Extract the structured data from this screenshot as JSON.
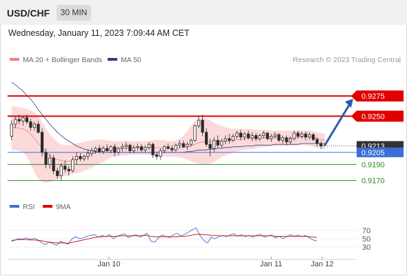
{
  "header": {
    "symbol": "USD/CHF",
    "timeframe": "30 MIN",
    "datetime": "Wednesday, January 11, 2023 7:09:44 AM CET"
  },
  "chart_data": [
    {
      "type": "candlestick",
      "legend": [
        {
          "label": "MA 20 + Bollinger Bands",
          "color": "#f08080"
        },
        {
          "label": "MA 50",
          "color": "#2c3e8c"
        }
      ],
      "credit": "Research © 2023 Trading Central",
      "legend_placement": "top-left",
      "x_tick_labels": [
        "Jan 10",
        "Jan 11",
        "Jan 12"
      ],
      "ylim": [
        0.915,
        0.93
      ],
      "levels": [
        {
          "value": 0.9275,
          "label": "0.9275",
          "kind": "target",
          "color": "#e00000"
        },
        {
          "value": 0.925,
          "label": "0.9250",
          "kind": "resistance",
          "color": "#e00000"
        },
        {
          "value": 0.9213,
          "label": "0.9213",
          "kind": "last-price",
          "color": "#333333"
        },
        {
          "value": 0.9205,
          "label": "0.9205",
          "kind": "pivot",
          "color": "#3a6fd8"
        },
        {
          "value": 0.919,
          "label": "0.9190",
          "kind": "support",
          "color": "#2e8b22"
        },
        {
          "value": 0.917,
          "label": "0.9170",
          "kind": "support",
          "color": "#2e8b22"
        }
      ],
      "colors": {
        "up": "#2a2a2a",
        "down": "#2a2a2a",
        "bollinger_fill": "#fcdada",
        "ma20": "#f08080",
        "ma50": "#2c3e8c",
        "arrow": "#2b5ea8"
      },
      "candles": [
        [
          0.9225,
          0.9245,
          0.922,
          0.924
        ],
        [
          0.924,
          0.925,
          0.9235,
          0.9246
        ],
        [
          0.9246,
          0.9252,
          0.924,
          0.9244
        ],
        [
          0.9244,
          0.925,
          0.9238,
          0.9248
        ],
        [
          0.9248,
          0.9252,
          0.924,
          0.9243
        ],
        [
          0.9243,
          0.9247,
          0.9232,
          0.9236
        ],
        [
          0.9236,
          0.9243,
          0.9232,
          0.924
        ],
        [
          0.924,
          0.9244,
          0.9228,
          0.923
        ],
        [
          0.923,
          0.9235,
          0.92,
          0.9205
        ],
        [
          0.9205,
          0.921,
          0.9185,
          0.919
        ],
        [
          0.919,
          0.9203,
          0.9185,
          0.9198
        ],
        [
          0.9198,
          0.9202,
          0.9178,
          0.9182
        ],
        [
          0.9182,
          0.9186,
          0.9172,
          0.9176
        ],
        [
          0.9176,
          0.9192,
          0.917,
          0.9188
        ],
        [
          0.9188,
          0.9195,
          0.918,
          0.9184
        ],
        [
          0.9184,
          0.9188,
          0.9176,
          0.9182
        ],
        [
          0.9182,
          0.92,
          0.918,
          0.9196
        ],
        [
          0.9196,
          0.9205,
          0.919,
          0.92
        ],
        [
          0.92,
          0.9204,
          0.9194,
          0.9197
        ],
        [
          0.9197,
          0.9202,
          0.9194,
          0.92
        ],
        [
          0.92,
          0.9208,
          0.9196,
          0.9204
        ],
        [
          0.9204,
          0.9211,
          0.92,
          0.9207
        ],
        [
          0.9207,
          0.9212,
          0.9203,
          0.921
        ],
        [
          0.921,
          0.9214,
          0.9204,
          0.9206
        ],
        [
          0.9206,
          0.9213,
          0.9203,
          0.921
        ],
        [
          0.921,
          0.9215,
          0.9205,
          0.9207
        ],
        [
          0.9207,
          0.9214,
          0.9204,
          0.9212
        ],
        [
          0.9212,
          0.9216,
          0.92,
          0.9205
        ],
        [
          0.9205,
          0.9212,
          0.9202,
          0.921
        ],
        [
          0.921,
          0.9216,
          0.9206,
          0.9212
        ],
        [
          0.9212,
          0.9218,
          0.9208,
          0.9214
        ],
        [
          0.9214,
          0.9216,
          0.9204,
          0.9207
        ],
        [
          0.9207,
          0.9214,
          0.9204,
          0.9211
        ],
        [
          0.9211,
          0.9216,
          0.9207,
          0.9212
        ],
        [
          0.9212,
          0.9215,
          0.9206,
          0.9208
        ],
        [
          0.9208,
          0.9214,
          0.9205,
          0.9211
        ],
        [
          0.9211,
          0.9218,
          0.9208,
          0.9215
        ],
        [
          0.9215,
          0.9217,
          0.9198,
          0.9202
        ],
        [
          0.9202,
          0.9206,
          0.9196,
          0.92
        ],
        [
          0.92,
          0.921,
          0.9196,
          0.9207
        ],
        [
          0.9207,
          0.9214,
          0.9204,
          0.9212
        ],
        [
          0.9212,
          0.9216,
          0.9208,
          0.921
        ],
        [
          0.921,
          0.9214,
          0.9205,
          0.9208
        ],
        [
          0.9208,
          0.9216,
          0.9206,
          0.9214
        ],
        [
          0.9214,
          0.922,
          0.921,
          0.9216
        ],
        [
          0.9216,
          0.922,
          0.921,
          0.9212
        ],
        [
          0.9212,
          0.9218,
          0.9208,
          0.9215
        ],
        [
          0.9215,
          0.9222,
          0.9212,
          0.922
        ],
        [
          0.922,
          0.924,
          0.9218,
          0.9238
        ],
        [
          0.9238,
          0.925,
          0.9235,
          0.9245
        ],
        [
          0.9245,
          0.9252,
          0.9225,
          0.923
        ],
        [
          0.923,
          0.9235,
          0.9212,
          0.9215
        ],
        [
          0.9215,
          0.9222,
          0.92,
          0.921
        ],
        [
          0.921,
          0.9224,
          0.9206,
          0.922
        ],
        [
          0.922,
          0.9226,
          0.921,
          0.9214
        ],
        [
          0.9214,
          0.9222,
          0.921,
          0.9219
        ],
        [
          0.9219,
          0.9226,
          0.9215,
          0.9222
        ],
        [
          0.9222,
          0.9228,
          0.9216,
          0.922
        ],
        [
          0.922,
          0.9228,
          0.9218,
          0.9225
        ],
        [
          0.9225,
          0.9232,
          0.9222,
          0.9229
        ],
        [
          0.9229,
          0.9233,
          0.922,
          0.9224
        ],
        [
          0.9224,
          0.923,
          0.922,
          0.9228
        ],
        [
          0.9228,
          0.9232,
          0.9221,
          0.9223
        ],
        [
          0.9223,
          0.923,
          0.9219,
          0.9226
        ],
        [
          0.9226,
          0.9229,
          0.9219,
          0.9222
        ],
        [
          0.9222,
          0.9228,
          0.9219,
          0.9226
        ],
        [
          0.9226,
          0.9232,
          0.9222,
          0.9229
        ],
        [
          0.9229,
          0.923,
          0.922,
          0.9222
        ],
        [
          0.9222,
          0.9228,
          0.9218,
          0.9225
        ],
        [
          0.9225,
          0.923,
          0.9222,
          0.9227
        ],
        [
          0.9227,
          0.9229,
          0.9218,
          0.922
        ],
        [
          0.922,
          0.9226,
          0.9216,
          0.9223
        ],
        [
          0.9223,
          0.9226,
          0.9214,
          0.9218
        ],
        [
          0.9218,
          0.9225,
          0.9215,
          0.9222
        ],
        [
          0.9222,
          0.9232,
          0.922,
          0.9229
        ],
        [
          0.9229,
          0.9232,
          0.9222,
          0.9225
        ],
        [
          0.9225,
          0.9231,
          0.9222,
          0.9228
        ],
        [
          0.9228,
          0.9231,
          0.922,
          0.9224
        ],
        [
          0.9224,
          0.923,
          0.9221,
          0.9227
        ],
        [
          0.9227,
          0.9229,
          0.9219,
          0.9221
        ],
        [
          0.9221,
          0.9224,
          0.9212,
          0.9216
        ],
        [
          0.9216,
          0.9219,
          0.9209,
          0.9213
        ]
      ],
      "x_tick_positions": [
        28,
        74,
        86
      ],
      "bands": {
        "ma20": [
          0.9236,
          0.9236,
          0.9235,
          0.9234,
          0.9232,
          0.9228,
          0.9222,
          0.9216,
          0.9211,
          0.9206,
          0.9201,
          0.9198,
          0.9196,
          0.9195,
          0.9194,
          0.9194,
          0.9195,
          0.9196,
          0.9198,
          0.9199,
          0.9201,
          0.9203,
          0.9205,
          0.9206,
          0.9207,
          0.9208,
          0.9209,
          0.9209,
          0.9209,
          0.921,
          0.921,
          0.9211,
          0.9211,
          0.9211,
          0.9211,
          0.9211,
          0.9211,
          0.9211,
          0.9211,
          0.921,
          0.921,
          0.921,
          0.921,
          0.921,
          0.9211,
          0.9211,
          0.9212,
          0.9213,
          0.9215,
          0.9217,
          0.9218,
          0.9218,
          0.9218,
          0.9219,
          0.9219,
          0.9219,
          0.9219,
          0.9219,
          0.922,
          0.9221,
          0.9221,
          0.9222,
          0.9222,
          0.9222,
          0.9222,
          0.9223,
          0.9223,
          0.9223,
          0.9223,
          0.9223,
          0.9223,
          0.9223,
          0.9223,
          0.9223,
          0.9223,
          0.9224,
          0.9224,
          0.9224,
          0.9224,
          0.9223,
          0.9222,
          0.9221,
          0.922
        ],
        "upper": [
          0.9262,
          0.9262,
          0.9261,
          0.926,
          0.9259,
          0.9257,
          0.9255,
          0.925,
          0.9242,
          0.9235,
          0.9228,
          0.9222,
          0.9218,
          0.9215,
          0.9214,
          0.9214,
          0.9215,
          0.9216,
          0.9217,
          0.9218,
          0.9219,
          0.922,
          0.9221,
          0.9221,
          0.9221,
          0.922,
          0.9219,
          0.9219,
          0.9219,
          0.9219,
          0.9219,
          0.9219,
          0.9219,
          0.9219,
          0.9219,
          0.9219,
          0.9219,
          0.922,
          0.9221,
          0.922,
          0.922,
          0.9219,
          0.9219,
          0.922,
          0.9222,
          0.9226,
          0.9232,
          0.9238,
          0.9244,
          0.9247,
          0.9248,
          0.9247,
          0.9245,
          0.9242,
          0.924,
          0.9238,
          0.9236,
          0.9235,
          0.9234,
          0.9234,
          0.9234,
          0.9234,
          0.9234,
          0.9234,
          0.9233,
          0.9233,
          0.9233,
          0.9233,
          0.9232,
          0.9232,
          0.9232,
          0.9232,
          0.9232,
          0.9232,
          0.9232,
          0.9232,
          0.9232,
          0.9232,
          0.9232,
          0.9231,
          0.923,
          0.9229,
          0.9228
        ],
        "lower": [
          0.9208,
          0.9208,
          0.9207,
          0.9205,
          0.92,
          0.919,
          0.918,
          0.9172,
          0.9168,
          0.9167,
          0.9168,
          0.917,
          0.9172,
          0.9174,
          0.9176,
          0.9177,
          0.9178,
          0.9179,
          0.918,
          0.9182,
          0.9184,
          0.9186,
          0.9189,
          0.9191,
          0.9193,
          0.9196,
          0.9199,
          0.92,
          0.92,
          0.9201,
          0.9201,
          0.9202,
          0.9202,
          0.9202,
          0.9202,
          0.9202,
          0.9202,
          0.9201,
          0.92,
          0.92,
          0.92,
          0.92,
          0.92,
          0.9199,
          0.9199,
          0.9198,
          0.9196,
          0.9194,
          0.9192,
          0.9191,
          0.919,
          0.919,
          0.9191,
          0.9193,
          0.9196,
          0.9199,
          0.9201,
          0.9203,
          0.9205,
          0.9206,
          0.9207,
          0.9208,
          0.9209,
          0.9209,
          0.921,
          0.9211,
          0.9212,
          0.9212,
          0.9213,
          0.9213,
          0.9213,
          0.9213,
          0.9213,
          0.9213,
          0.9213,
          0.9214,
          0.9214,
          0.9214,
          0.9213,
          0.9212,
          0.9211,
          0.921,
          0.9209
        ],
        "ma50": [
          0.9292,
          0.9289,
          0.9285,
          0.9281,
          0.9276,
          0.9271,
          0.9265,
          0.9258,
          0.9252,
          0.9246,
          0.924,
          0.9235,
          0.923,
          0.9226,
          0.9222,
          0.9219,
          0.9216,
          0.9213,
          0.9211,
          0.9209,
          0.9208,
          0.9207,
          0.9206,
          0.9205,
          0.9205,
          0.9205,
          0.9205,
          0.9205,
          0.9205,
          0.9205,
          0.9205,
          0.9205,
          0.9205,
          0.9205,
          0.9205,
          0.9205,
          0.9205,
          0.9205,
          0.9205,
          0.9205,
          0.9205,
          0.9205,
          0.9205,
          0.9205,
          0.9205,
          0.9205,
          0.9206,
          0.9206,
          0.9207,
          0.9208,
          0.9208,
          0.9208,
          0.9209,
          0.9209,
          0.921,
          0.921,
          0.9211,
          0.9211,
          0.9212,
          0.9212,
          0.9212,
          0.9213,
          0.9213,
          0.9213,
          0.9214,
          0.9214,
          0.9214,
          0.9214,
          0.9214,
          0.9215,
          0.9215,
          0.9215,
          0.9215,
          0.9215,
          0.9215,
          0.9215,
          0.9216,
          0.9216,
          0.9216,
          0.9216,
          0.9216,
          0.9216,
          0.9216
        ]
      },
      "projection": {
        "from": 0.9213,
        "to": 0.9275
      }
    },
    {
      "type": "line",
      "legend": [
        {
          "label": "RSI",
          "color": "#3a6fd8"
        },
        {
          "label": "9MA",
          "color": "#e00000"
        }
      ],
      "y_ticks": [
        70,
        50,
        30
      ],
      "ylim": [
        20,
        80
      ],
      "series": [
        {
          "name": "RSI",
          "values": [
            44,
            47,
            50,
            49,
            52,
            48,
            51,
            47,
            40,
            36,
            42,
            38,
            34,
            44,
            40,
            37,
            49,
            55,
            50,
            52,
            56,
            58,
            60,
            54,
            58,
            55,
            60,
            50,
            56,
            59,
            62,
            53,
            57,
            60,
            54,
            58,
            63,
            44,
            42,
            52,
            59,
            55,
            53,
            60,
            63,
            56,
            61,
            66,
            72,
            76,
            58,
            46,
            40,
            54,
            50,
            55,
            58,
            55,
            59,
            62,
            56,
            60,
            55,
            58,
            54,
            58,
            61,
            54,
            57,
            59,
            52,
            56,
            50,
            55,
            60,
            56,
            59,
            55,
            58,
            52,
            47,
            45
          ]
        },
        {
          "name": "9MA",
          "values": [
            46,
            47,
            48,
            48,
            48,
            47,
            47,
            46,
            45,
            43,
            42,
            41,
            40,
            40,
            40,
            39,
            41,
            43,
            45,
            47,
            49,
            51,
            53,
            54,
            55,
            56,
            56,
            56,
            56,
            57,
            57,
            57,
            57,
            57,
            57,
            58,
            58,
            56,
            55,
            55,
            55,
            55,
            55,
            55,
            55,
            56,
            56,
            57,
            59,
            61,
            61,
            60,
            59,
            58,
            58,
            57,
            57,
            57,
            57,
            57,
            57,
            57,
            57,
            57,
            57,
            57,
            57,
            57,
            57,
            57,
            56,
            56,
            56,
            56,
            56,
            56,
            56,
            56,
            56,
            55,
            54,
            53
          ]
        }
      ]
    }
  ]
}
